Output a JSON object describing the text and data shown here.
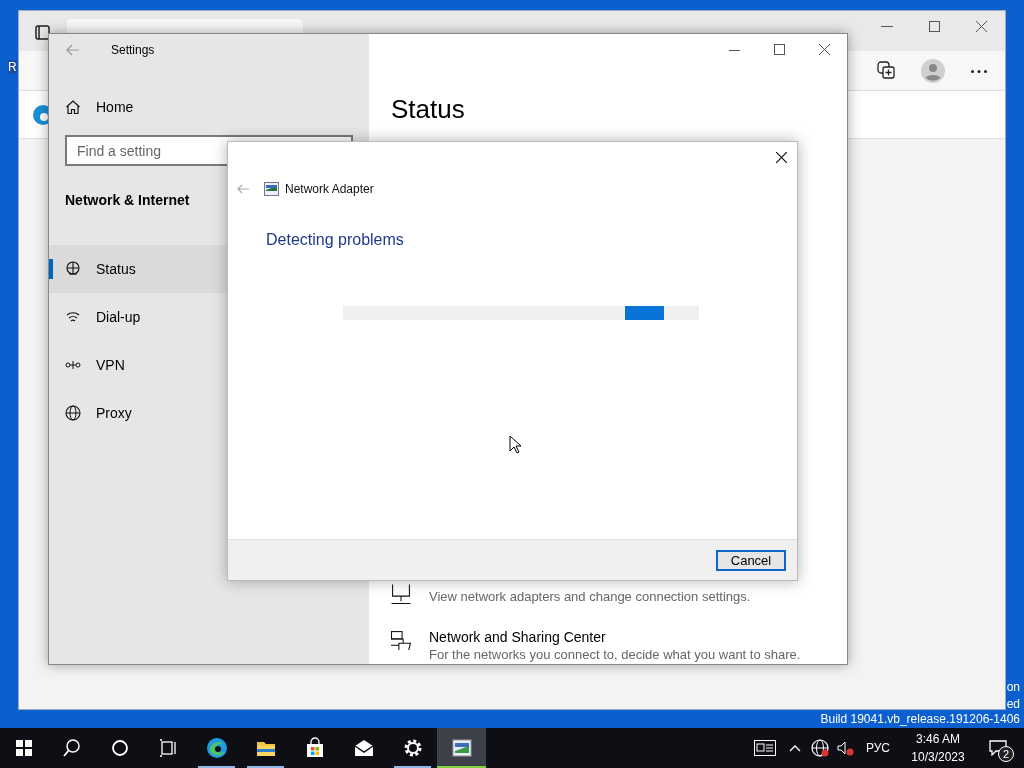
{
  "desktop": {
    "left_labels": [
      "R"
    ],
    "right_labels": [
      "on",
      "ed"
    ],
    "build_text": "Build 19041.vb_release.191206-1406"
  },
  "settings": {
    "title": "Settings",
    "home": "Home",
    "search": {
      "placeholder": "Find a setting"
    },
    "section": "Network & Internet",
    "nav": [
      {
        "kind": "status",
        "label": "Status",
        "selected": true
      },
      {
        "kind": "dialup",
        "label": "Dial-up",
        "selected": false
      },
      {
        "kind": "vpn",
        "label": "VPN",
        "selected": false
      },
      {
        "kind": "proxy",
        "label": "Proxy",
        "selected": false
      }
    ],
    "heading": "Status",
    "links": [
      {
        "kind": "adapter",
        "description": "View network adapters and change connection settings."
      },
      {
        "kind": "sharing",
        "title": "Network and Sharing Center",
        "description": "For the networks you connect to, decide what you want to share."
      }
    ]
  },
  "dialog": {
    "title": "Network Adapter",
    "heading": "Detecting problems",
    "cancel": "Cancel"
  },
  "taskbar": {
    "apps": [
      {
        "kind": "edge",
        "running": true,
        "selected": false
      },
      {
        "kind": "explorer",
        "running": true,
        "selected": false
      },
      {
        "kind": "store",
        "running": false,
        "selected": false
      },
      {
        "kind": "mail",
        "running": false,
        "selected": false
      },
      {
        "kind": "settings",
        "running": true,
        "selected": false
      },
      {
        "kind": "troubleshooter",
        "running": true,
        "selected": true
      }
    ],
    "language": "РУС",
    "time": "3:46 AM",
    "date": "10/3/2023",
    "notifications": "2"
  }
}
